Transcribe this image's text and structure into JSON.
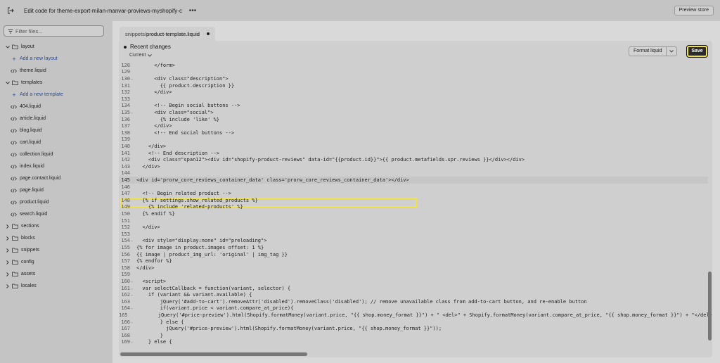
{
  "topbar": {
    "title": "Edit code for theme-export-milan-manvar-proviews-myshopify-c",
    "more_label": "•••",
    "preview_label": "Preview store"
  },
  "sidebar": {
    "filter_placeholder": "Filter files...",
    "tree": [
      {
        "kind": "folder",
        "label": "layout",
        "expanded": true
      },
      {
        "kind": "add",
        "label": "Add a new layout"
      },
      {
        "kind": "file",
        "label": "theme.liquid"
      },
      {
        "kind": "folder",
        "label": "templates",
        "expanded": true
      },
      {
        "kind": "add",
        "label": "Add a new template"
      },
      {
        "kind": "file",
        "label": "404.liquid"
      },
      {
        "kind": "file",
        "label": "article.liquid"
      },
      {
        "kind": "file",
        "label": "blog.liquid"
      },
      {
        "kind": "file",
        "label": "cart.liquid"
      },
      {
        "kind": "file",
        "label": "collection.liquid"
      },
      {
        "kind": "file",
        "label": "index.liquid"
      },
      {
        "kind": "file",
        "label": "page.contact.liquid"
      },
      {
        "kind": "file",
        "label": "page.liquid"
      },
      {
        "kind": "file",
        "label": "product.liquid"
      },
      {
        "kind": "file",
        "label": "search.liquid"
      },
      {
        "kind": "folder",
        "label": "sections",
        "expanded": false
      },
      {
        "kind": "folder",
        "label": "blocks",
        "expanded": false
      },
      {
        "kind": "folder",
        "label": "snippets",
        "expanded": false
      },
      {
        "kind": "folder",
        "label": "config",
        "expanded": false
      },
      {
        "kind": "folder",
        "label": "assets",
        "expanded": false
      },
      {
        "kind": "folder",
        "label": "locales",
        "expanded": false
      }
    ]
  },
  "editor": {
    "tab_path": "snippets/",
    "tab_file": "product-template.liquid",
    "recent_changes": "Recent changes",
    "current_label": "Current",
    "format_label": "Format liquid",
    "save_label": "Save",
    "active_line": "145",
    "lines": [
      {
        "n": "128",
        "fold": false,
        "text": "      </form>"
      },
      {
        "n": "129",
        "fold": false,
        "text": ""
      },
      {
        "n": "130",
        "fold": true,
        "text": "      <div class=\"description\">"
      },
      {
        "n": "131",
        "fold": false,
        "text": "        {{ product.description }}"
      },
      {
        "n": "132",
        "fold": false,
        "text": "      </div>"
      },
      {
        "n": "133",
        "fold": false,
        "text": ""
      },
      {
        "n": "134",
        "fold": false,
        "text": "      <!-- Begin social buttons -->"
      },
      {
        "n": "135",
        "fold": true,
        "text": "      <div class=\"social\">"
      },
      {
        "n": "136",
        "fold": false,
        "text": "        {% include 'like' %}"
      },
      {
        "n": "137",
        "fold": false,
        "text": "      </div>"
      },
      {
        "n": "138",
        "fold": false,
        "text": "      <!-- End social buttons -->"
      },
      {
        "n": "139",
        "fold": false,
        "text": ""
      },
      {
        "n": "140",
        "fold": false,
        "text": "    </div>"
      },
      {
        "n": "141",
        "fold": false,
        "text": "    <!-- End description -->"
      },
      {
        "n": "142",
        "fold": false,
        "text": "    <div class=\"span12\"><div id=\"shopify-product-reviews\" data-id=\"{{product.id}}\">{{ product.metafields.spr.reviews }}</div></div>"
      },
      {
        "n": "143",
        "fold": false,
        "text": "  </div>"
      },
      {
        "n": "144",
        "fold": false,
        "text": ""
      },
      {
        "n": "145",
        "fold": false,
        "text": "<div id='prorw_core_reviews_container_data' class='prorw_core_reviews_container_data'></div>"
      },
      {
        "n": "146",
        "fold": false,
        "text": ""
      },
      {
        "n": "147",
        "fold": false,
        "text": "  <!-- Begin related product -->"
      },
      {
        "n": "148",
        "fold": false,
        "text": "  {% if settings.show_related_products %}"
      },
      {
        "n": "149",
        "fold": false,
        "text": "    {% include 'related-products' %}"
      },
      {
        "n": "150",
        "fold": false,
        "text": "  {% endif %}"
      },
      {
        "n": "151",
        "fold": false,
        "text": ""
      },
      {
        "n": "152",
        "fold": false,
        "text": "  </div>"
      },
      {
        "n": "153",
        "fold": false,
        "text": ""
      },
      {
        "n": "154",
        "fold": true,
        "text": "  <div style=\"display:none\" id=\"preloading\">"
      },
      {
        "n": "155",
        "fold": false,
        "text": "{% for image in product.images offset: 1 %}"
      },
      {
        "n": "156",
        "fold": false,
        "text": "{{ image | product_img_url: 'original' | img_tag }}"
      },
      {
        "n": "157",
        "fold": false,
        "text": "{% endfor %}"
      },
      {
        "n": "158",
        "fold": false,
        "text": "</div>"
      },
      {
        "n": "159",
        "fold": false,
        "text": ""
      },
      {
        "n": "160",
        "fold": true,
        "text": "  <script>"
      },
      {
        "n": "161",
        "fold": true,
        "text": "  var selectCallback = function(variant, selector) {"
      },
      {
        "n": "162",
        "fold": true,
        "text": "    if (variant && variant.available) {"
      },
      {
        "n": "163",
        "fold": false,
        "text": "        jQuery('#add-to-cart').removeAttr('disabled').removeClass('disabled'); // remove unavailable class from add-to-cart button, and re-enable button"
      },
      {
        "n": "164",
        "fold": true,
        "text": "        if(variant.price < variant.compare_at_price){"
      },
      {
        "n": "165",
        "fold": false,
        "text": "          jQuery('#price-preview').html(Shopify.formatMoney(variant.price, \"{{ shop.money_format }}\") + \" <del>\" + Shopify.formatMoney(variant.compare_at_price, \"{{ shop.money_format }}\") + \"</del>\");"
      },
      {
        "n": "166",
        "fold": true,
        "text": "        } else {"
      },
      {
        "n": "167",
        "fold": false,
        "text": "          jQuery('#price-preview').html(Shopify.formatMoney(variant.price, \"{{ shop.money_format }}\"));"
      },
      {
        "n": "168",
        "fold": false,
        "text": "        }"
      },
      {
        "n": "169",
        "fold": true,
        "text": "    } else {"
      }
    ]
  },
  "colors": {
    "highlight": "#f0e04a",
    "save_bg": "#2a2a2a",
    "link": "#2c4a9c"
  }
}
